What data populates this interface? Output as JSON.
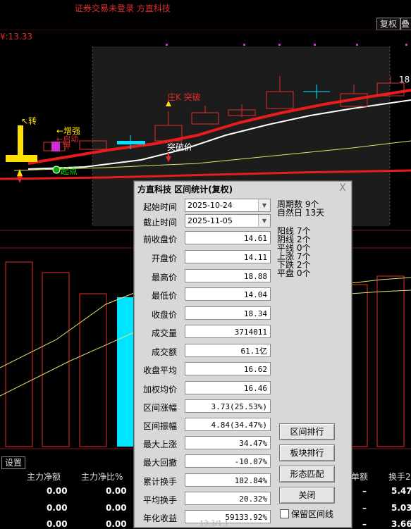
{
  "app": {
    "title": "证券交易未登录  方直科技"
  },
  "toolbar": {
    "fq_label": "复权",
    "fq_label2": "叠"
  },
  "price_axis": {
    "current_price": "¥:13.33"
  },
  "chart_annotations": {
    "zhuan": "↖转",
    "zengqiang": "←增强",
    "qidong": "←启动",
    "jia": "钾",
    "zhuang_k": "庄K 突破",
    "tupo_jia": "突破价",
    "top_price": "18",
    "qidian": "起点"
  },
  "dialog": {
    "title": "方直科技  区间统计(复权)",
    "close": "X",
    "start_label": "起始时间",
    "start_value": "2025-10-24",
    "end_label": "截止时间",
    "end_value": "2025-11-05",
    "fields": [
      {
        "label": "前收盘价",
        "value": "14.61"
      },
      {
        "label": "开盘价",
        "value": "14.11"
      },
      {
        "label": "最高价",
        "value": "18.88"
      },
      {
        "label": "最低价",
        "value": "14.04"
      },
      {
        "label": "收盘价",
        "value": "18.34"
      },
      {
        "label": "成交量",
        "value": "3714011"
      },
      {
        "label": "成交额",
        "value": "61.1亿"
      },
      {
        "label": "收盘平均",
        "value": "16.62"
      },
      {
        "label": "加权均价",
        "value": "16.46"
      },
      {
        "label": "区间涨幅",
        "value": "3.73(25.53%)"
      },
      {
        "label": "区间振幅",
        "value": "4.84(34.47%)"
      },
      {
        "label": "最大上涨",
        "value": "34.47%"
      },
      {
        "label": "最大回撤",
        "value": "-10.07%"
      },
      {
        "label": "累计换手",
        "value": "182.84%"
      },
      {
        "label": "平均换手",
        "value": "20.32%"
      },
      {
        "label": "年化收益",
        "value": "59133.92%"
      }
    ],
    "stats": [
      "周期数  9个",
      "自然日  13天",
      "阳线  7个",
      "阴线  2个",
      "平线  0个",
      "上涨  7个",
      "下跌  2个",
      "平盘  0个"
    ],
    "buttons": {
      "range_rank": "区间排行",
      "sector_rank": "板块排行",
      "pattern_match": "形态匹配",
      "close": "关闭"
    },
    "keep_line_label": "保留区间线"
  },
  "bottom_table": {
    "settings_tab": "设置",
    "headers": [
      "主力净额",
      "主力净比%",
      "单额",
      "换手2"
    ],
    "rows": [
      [
        "0.00",
        "0.00",
        "–",
        "5.47"
      ],
      [
        "0.00",
        "0.00",
        "–",
        "5.03"
      ],
      [
        "0.00",
        "0.00",
        "–",
        "3.66"
      ]
    ],
    "partial_cell": "13.3/1.1"
  },
  "colors": {
    "bg": "#000000",
    "up": "#e32b2b",
    "down": "#00e5ff",
    "dialog_bg": "#d8d8d8",
    "accent_yellow": "#ffe000"
  }
}
